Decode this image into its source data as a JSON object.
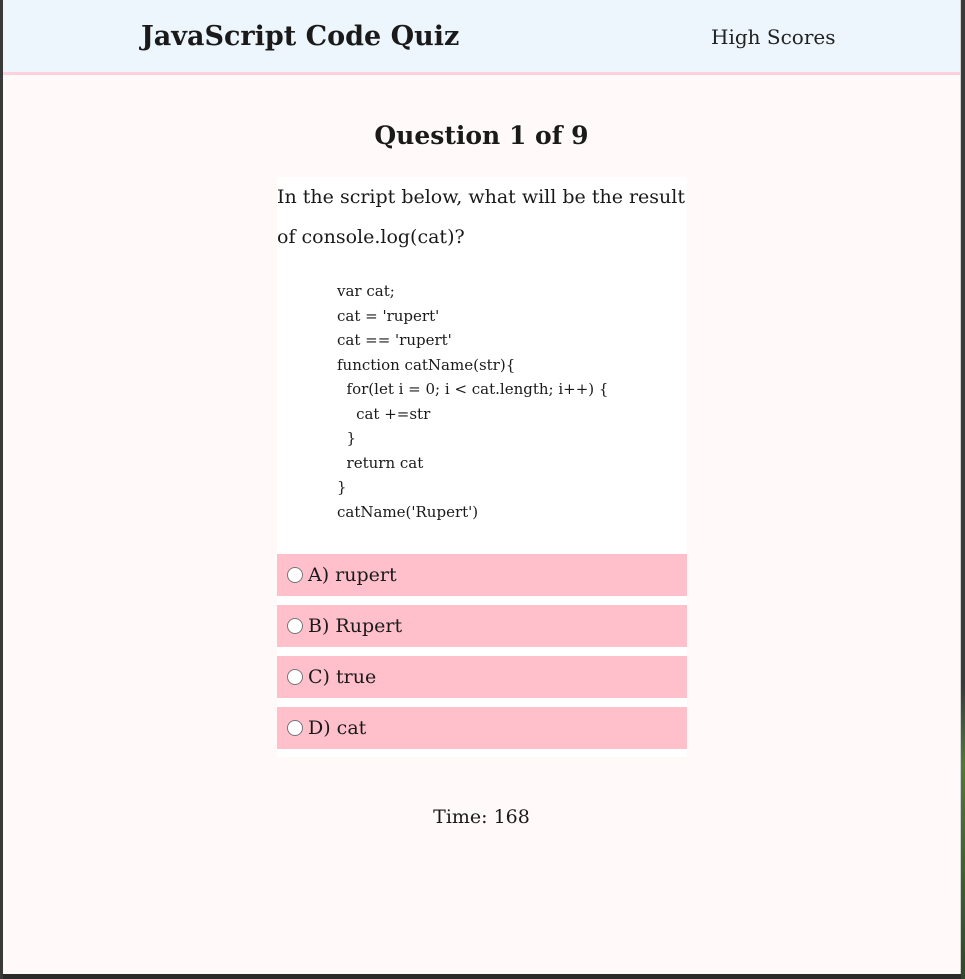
{
  "header": {
    "title": "JavaScript Code Quiz",
    "high_scores_link": "High Scores"
  },
  "quiz": {
    "question_heading": "Question 1 of 9",
    "prompt": "In the script below, what will be the result of console.log(cat)?",
    "code": "var cat;\ncat = 'rupert'\ncat == 'rupert'\nfunction catName(str){\n  for(let i = 0; i < cat.length; i++) {\n    cat +=str\n  }\n  return cat\n}\ncatName('Rupert')",
    "choices": [
      {
        "label": "A) rupert",
        "selected": false
      },
      {
        "label": "B) Rupert",
        "selected": false
      },
      {
        "label": "C) true",
        "selected": false
      },
      {
        "label": "D) cat",
        "selected": false
      }
    ],
    "timer": "Time: 168"
  },
  "colors": {
    "header_background": "#eef6fd",
    "header_border": "#ffd1dc",
    "page_background": "#fffaf9",
    "choice_background": "#ffc0cb"
  }
}
